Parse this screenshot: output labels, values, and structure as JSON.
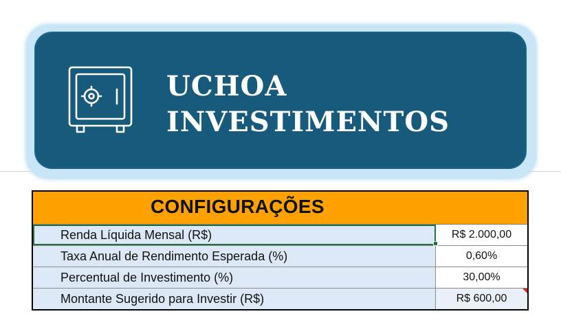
{
  "banner": {
    "title_line1": "UCHOA",
    "title_line2": "INVESTIMENTOS",
    "icon": "safe-icon",
    "colors": {
      "background": "#175a7c",
      "glow": "#c9e6f7",
      "text": "#ffffff"
    }
  },
  "config": {
    "header": "CONFIGURAÇÕES",
    "header_color": "#ffa200",
    "rows": [
      {
        "label": "Renda Líquida Mensal (R$)",
        "value": "R$ 2.000,00"
      },
      {
        "label": "Taxa Anual de Rendimento Esperada (%)",
        "value": "0,60%"
      },
      {
        "label": "Percentual de Investimento (%)",
        "value": "30,00%"
      },
      {
        "label": "Montante Sugerido para Investir (R$)",
        "value": "R$ 600,00"
      }
    ]
  }
}
